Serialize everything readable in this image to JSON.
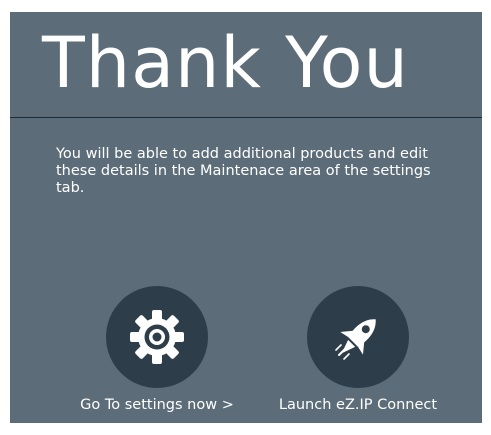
{
  "page": {
    "title": "Thank You",
    "message": "You will be able to add additional products and edit these details in the Maintenace area of the settings tab."
  },
  "actions": {
    "settings": {
      "label": "Go To settings now >",
      "icon": "gear-icon"
    },
    "launch": {
      "label": "Launch eZ.IP Connect",
      "icon": "rocket-icon"
    }
  },
  "colors": {
    "panel_background": "#5c6d79",
    "icon_circle": "#2e3d4a",
    "divider": "#1f2a33",
    "text": "#ffffff"
  }
}
